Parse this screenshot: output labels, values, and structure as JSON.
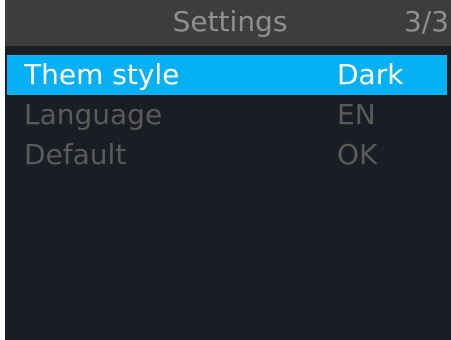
{
  "header": {
    "title": "Settings",
    "page_indicator": "3/3"
  },
  "colors": {
    "screen_background": "#1b1d24",
    "header_background": "#3d3d3d",
    "selection_highlight": "#06b0f4",
    "selected_text": "#ffffff",
    "inactive_text": "#5a5a5a",
    "header_text": "#8f8f8f"
  },
  "settings": {
    "selected_index": 0,
    "items": [
      {
        "label": "Them style",
        "value": "Dark"
      },
      {
        "label": "Language",
        "value": "EN"
      },
      {
        "label": "Default",
        "value": "OK"
      }
    ]
  }
}
